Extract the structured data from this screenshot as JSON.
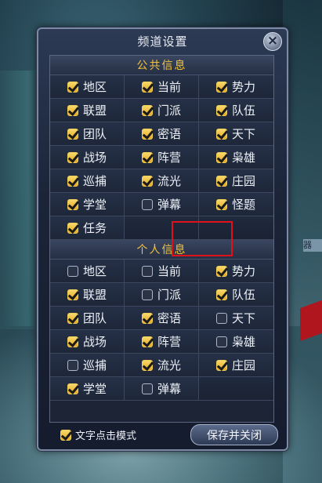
{
  "dialog": {
    "title": "频道设置",
    "close_symbol": "×"
  },
  "public_section": {
    "title": "公共信息",
    "items": [
      {
        "label": "地区",
        "checked": true
      },
      {
        "label": "当前",
        "checked": true
      },
      {
        "label": "势力",
        "checked": true
      },
      {
        "label": "联盟",
        "checked": true
      },
      {
        "label": "门派",
        "checked": true
      },
      {
        "label": "队伍",
        "checked": true
      },
      {
        "label": "团队",
        "checked": true
      },
      {
        "label": "密语",
        "checked": true
      },
      {
        "label": "天下",
        "checked": true
      },
      {
        "label": "战场",
        "checked": true
      },
      {
        "label": "阵营",
        "checked": true
      },
      {
        "label": "枭雄",
        "checked": true
      },
      {
        "label": "巡捕",
        "checked": true
      },
      {
        "label": "流光",
        "checked": true
      },
      {
        "label": "庄园",
        "checked": true
      },
      {
        "label": "学堂",
        "checked": true
      },
      {
        "label": "弹幕",
        "checked": false
      },
      {
        "label": "怪题",
        "checked": true
      },
      {
        "label": "任务",
        "checked": true
      }
    ]
  },
  "personal_section": {
    "title": "个人信息",
    "items": [
      {
        "label": "地区",
        "checked": false
      },
      {
        "label": "当前",
        "checked": false
      },
      {
        "label": "势力",
        "checked": true
      },
      {
        "label": "联盟",
        "checked": true
      },
      {
        "label": "门派",
        "checked": false
      },
      {
        "label": "队伍",
        "checked": true
      },
      {
        "label": "团队",
        "checked": true
      },
      {
        "label": "密语",
        "checked": true
      },
      {
        "label": "天下",
        "checked": false
      },
      {
        "label": "战场",
        "checked": true
      },
      {
        "label": "阵营",
        "checked": true
      },
      {
        "label": "枭雄",
        "checked": false
      },
      {
        "label": "巡捕",
        "checked": false
      },
      {
        "label": "流光",
        "checked": true
      },
      {
        "label": "庄园",
        "checked": true
      },
      {
        "label": "学堂",
        "checked": true
      },
      {
        "label": "弹幕",
        "checked": false
      }
    ]
  },
  "footer": {
    "text_click_mode": {
      "label": "文字点击模式",
      "checked": true
    },
    "save_button_label": "保存并关闭"
  },
  "background_tag": "器"
}
